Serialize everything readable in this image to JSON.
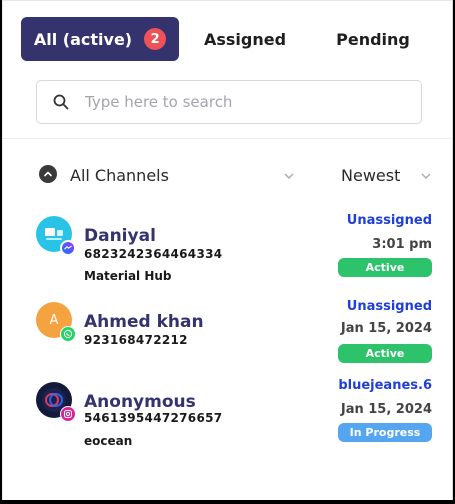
{
  "tabs": [
    {
      "label": "All (active)",
      "badge": "2"
    },
    {
      "label": "Assigned"
    },
    {
      "label": "Pending"
    }
  ],
  "search": {
    "placeholder": "Type here to search",
    "value": ""
  },
  "filters": {
    "channel_label": "All Channels",
    "sort_label": "Newest"
  },
  "conversations": [
    {
      "name": "Daniyal",
      "phone": "6823242364464334",
      "subtitle": "Material Hub",
      "assignee": "Unassigned",
      "time": "3:01 pm",
      "status": "Active",
      "channel": "messenger",
      "avatar_letter": ""
    },
    {
      "name": "Ahmed khan",
      "phone": "923168472212",
      "subtitle": "",
      "assignee": "Unassigned",
      "time": "Jan 15, 2024",
      "status": "Active",
      "channel": "whatsapp",
      "avatar_letter": "A"
    },
    {
      "name": "Anonymous",
      "phone": "5461395447276657",
      "subtitle": "eocean",
      "assignee": "bluejeanes.6",
      "time": "Jan 15, 2024",
      "status": "In Progress",
      "channel": "instagram",
      "avatar_letter": ""
    }
  ],
  "colors": {
    "active_tab": "#34336e",
    "badge": "#ee5157",
    "assignee_text": "#1f3fd8",
    "status_active": "#2dc36a",
    "status_in_progress": "#55a5f1",
    "whatsapp": "#25d366",
    "avatar_orange": "#f5a340",
    "avatar_cyan": "#29c3e8"
  },
  "icons": {
    "search": "search-icon",
    "channels": "chevron-up-circle-icon",
    "dropdown": "chevron-down-icon",
    "messenger": "messenger-icon",
    "whatsapp": "whatsapp-icon",
    "instagram": "instagram-icon"
  }
}
